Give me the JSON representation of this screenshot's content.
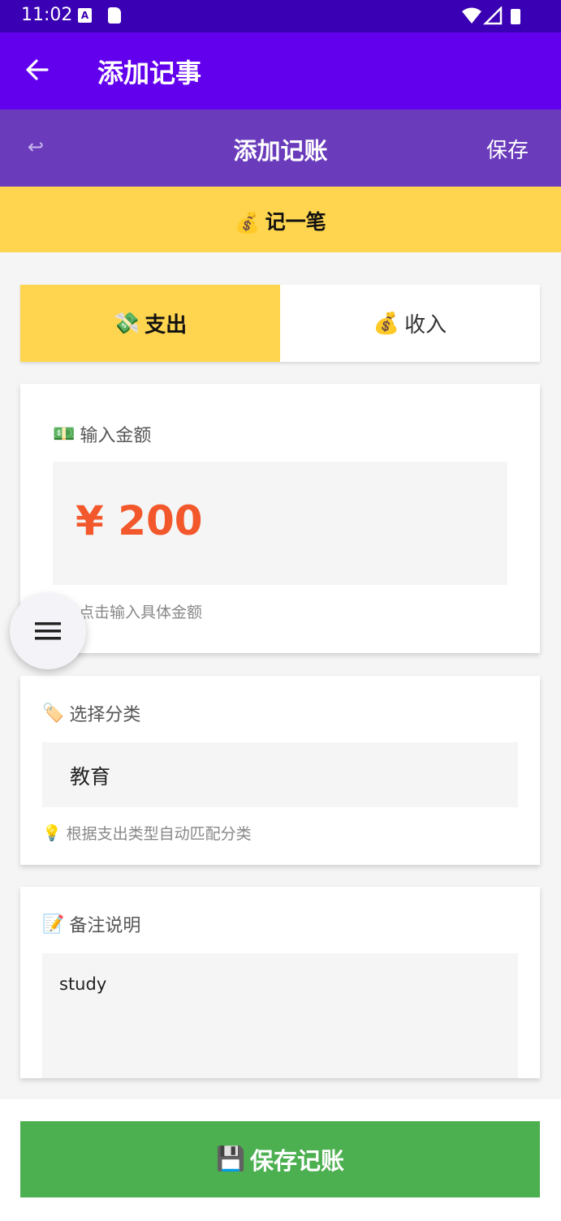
{
  "status_bar": {
    "time": "11:02",
    "a_icon_letter": "A"
  },
  "app_bar": {
    "title": "添加记事",
    "back_icon": "arrow-left-icon"
  },
  "sub_header": {
    "undo_icon": "↩",
    "title": "添加记账",
    "save_label": "保存"
  },
  "banner": {
    "emoji": "💰",
    "label": "记一笔"
  },
  "tabs": [
    {
      "emoji": "💸",
      "label": "支出",
      "active": true
    },
    {
      "emoji": "💰",
      "label": "收入",
      "active": false
    }
  ],
  "amount": {
    "emoji": "💵",
    "label": "输入金额",
    "value": "¥ 200",
    "hint": "点击输入具体金额"
  },
  "category": {
    "emoji": "🏷️",
    "label": "选择分类",
    "value": "教育",
    "hint_emoji": "💡",
    "hint": "根据支出类型自动匹配分类"
  },
  "note": {
    "emoji": "📝",
    "label": "备注说明",
    "value": "study"
  },
  "fab": {
    "icon": "menu-icon"
  },
  "save_button": {
    "emoji": "💾",
    "label": "保存记账"
  },
  "colors": {
    "status_bar": "#3a00b3",
    "app_bar": "#6200ee",
    "sub_header": "#6a3cbc",
    "accent_yellow": "#ffd54f",
    "amount_orange": "#f2582b",
    "save_green": "#4caf50"
  }
}
